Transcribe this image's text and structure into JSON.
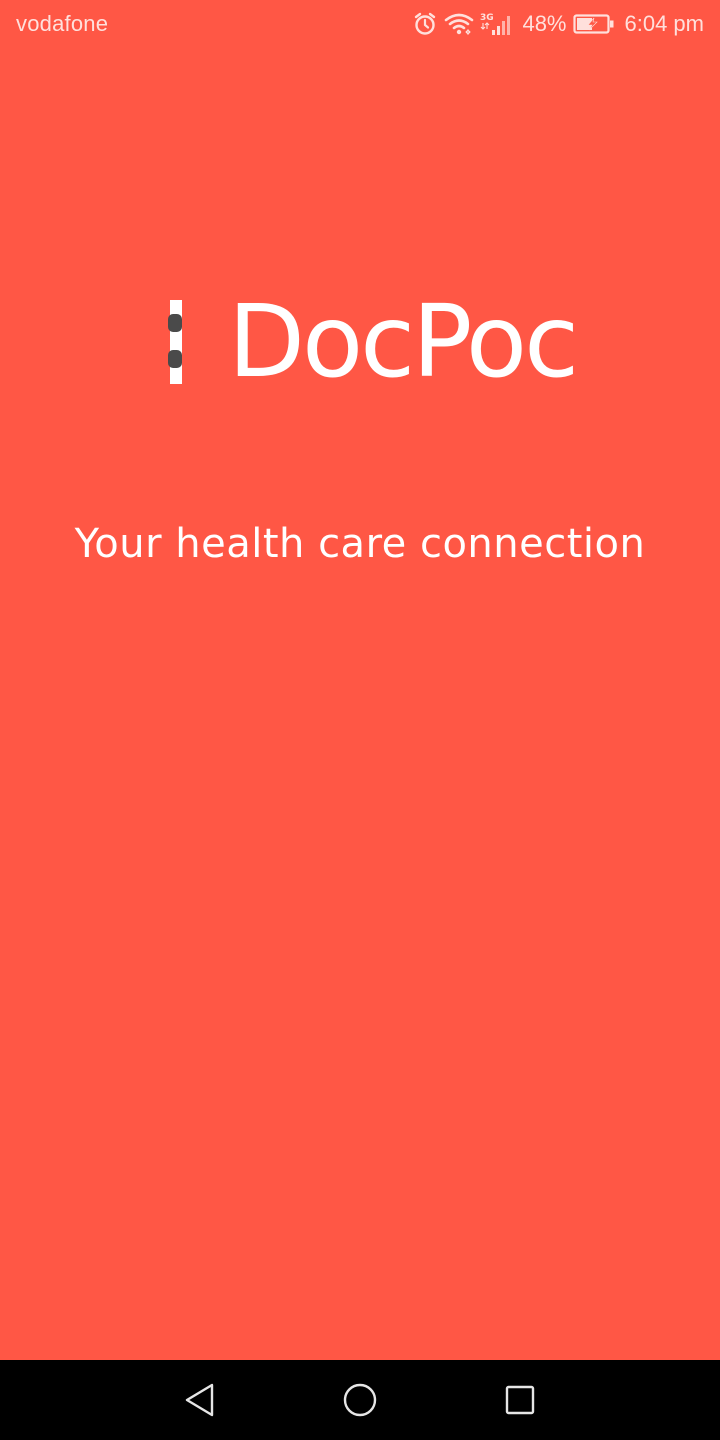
{
  "status_bar": {
    "carrier": "vodafone",
    "network_type": "3G",
    "battery_percent": "48%",
    "time": "6:04 pm",
    "icons": [
      "alarm-icon",
      "wifi-icon",
      "cellular-signal-icon",
      "battery-charging-icon"
    ]
  },
  "splash": {
    "logo_text": "DocPoc",
    "tagline": "Your health care connection"
  },
  "navigation": {
    "buttons": [
      "back-icon",
      "home-icon",
      "recents-icon"
    ]
  },
  "colors": {
    "background": "#ff5745",
    "logo_text": "#ffffff",
    "logo_accent": "#4a4a4a",
    "nav_bar": "#000000"
  }
}
